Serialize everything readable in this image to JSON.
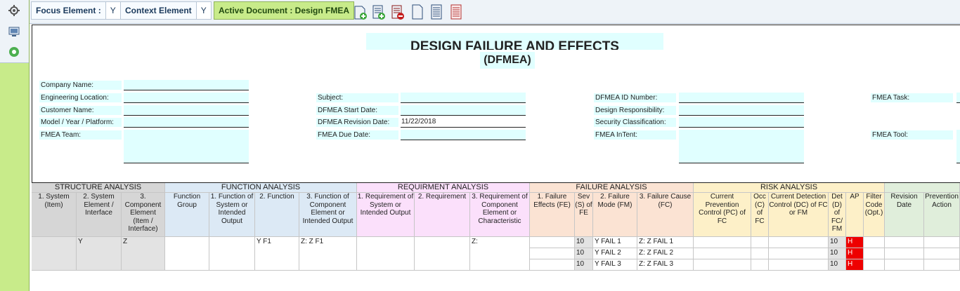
{
  "toolbar": {
    "focus_label": "Focus Element :",
    "focus_value": "Y",
    "context_label": "Context Element",
    "context_value": "Y",
    "active_document": "Active Document : Design FMEA"
  },
  "header": {
    "title_line1": "DESIGN FAILURE AND EFFECTS",
    "title_line2": "(DFMEA)",
    "fields": {
      "company_name": {
        "label": "Company Name:",
        "value": ""
      },
      "engineering_location": {
        "label": "Engineering Location:",
        "value": ""
      },
      "customer_name": {
        "label": "Customer Name:",
        "value": ""
      },
      "model_year_platform": {
        "label": "Model / Year / Platform:",
        "value": ""
      },
      "fmea_team": {
        "label": "FMEA Team:",
        "value": ""
      },
      "subject": {
        "label": "Subject:",
        "value": ""
      },
      "start_date": {
        "label": "DFMEA Start Date:",
        "value": ""
      },
      "revision_date": {
        "label": "DFMEA Revision Date:",
        "value": "11/22/2018"
      },
      "due_date": {
        "label": "FMEA Due Date:",
        "value": ""
      },
      "id_number": {
        "label": "DFMEA ID Number:",
        "value": ""
      },
      "design_responsibility": {
        "label": "Design Responsibility:",
        "value": ""
      },
      "security_classification": {
        "label": "Security Classification:",
        "value": ""
      },
      "fmea_intent": {
        "label": "FMEA InTent:",
        "value": ""
      },
      "fmea_task": {
        "label": "FMEA Task:",
        "value": ""
      },
      "fmea_tool": {
        "label": "FMEA Tool:",
        "value": ""
      }
    }
  },
  "groups": {
    "structure": "STRUCTURE ANALYSIS",
    "function": "FUNCTION ANALYSIS",
    "requirement": "REQUIRMENT ANALYSIS",
    "failure": "FAILURE ANALYSIS",
    "risk": "RISK ANALYSIS"
  },
  "columns": {
    "system_item": "1. System (Item)",
    "system_element": "2. System Element / Interface",
    "component_element": "3. Component Element (Item / Interface)",
    "function_group": "Function Group",
    "function_system": "1. Function of System or Intended Output",
    "function": "2. Function",
    "function_component": "3. Function of Component Element or Intended Output",
    "req_system": "1. Requirement of System or Intended Output",
    "requirement": "2. Requirement",
    "req_component": "3. Requirement of Component Element or Characteristic",
    "failure_effects": "1. Failure Effects (FE)",
    "severity": "Sev (S) of FE",
    "failure_mode": "2. Failure Mode (FM)",
    "failure_cause": "3. Failure Cause (FC)",
    "prevention_control": "Current Prevention Control (PC) of FC",
    "occurrence": "Occ (C) of FC",
    "detection_control": "Current Detection Control (DC) of FC or FM",
    "detection": "Det (D) of FC/ FM",
    "ap": "AP",
    "filter_code": "Filter Code (Opt.)",
    "revision_date": "Revision Date",
    "prevention_action": "Prevention Action"
  },
  "row": {
    "system_element": "Y",
    "component_element": "Z",
    "function": "Y F1",
    "function_component": "Z: Z F1",
    "req_component": "Z:"
  },
  "failures": [
    {
      "sev": "10",
      "mode": "Y FAIL 1",
      "cause": "Z: Z FAIL 1",
      "det": "10",
      "ap": "H"
    },
    {
      "sev": "10",
      "mode": "Y FAIL 2",
      "cause": "Z: Z FAIL 2",
      "det": "10",
      "ap": "H"
    },
    {
      "sev": "10",
      "mode": "Y FAIL 3",
      "cause": "Z: Z FAIL 3",
      "det": "10",
      "ap": "H"
    }
  ],
  "colors": {
    "ap_high": "#ee0000",
    "accent_green": "#c8eb8a"
  }
}
